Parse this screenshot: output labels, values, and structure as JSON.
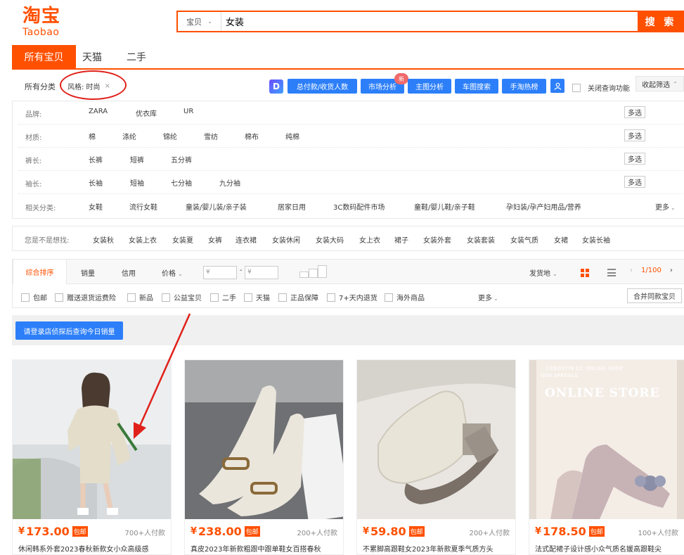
{
  "logo": {
    "cn": "淘宝",
    "en": "Taobao"
  },
  "search": {
    "scope": "宝贝",
    "value": "女装",
    "button": "搜 索"
  },
  "tabs": [
    "所有宝贝",
    "天猫",
    "二手"
  ],
  "crumb": {
    "label": "所有分类",
    "tag": "风格: 时尚",
    "close": "×"
  },
  "tools": {
    "d_icon": "D",
    "buttons": [
      "总付款/收货人数",
      "市场分析",
      "主图分析",
      "车图搜索",
      "手淘热榜"
    ],
    "new_badge": "新",
    "close_query": "关闭查询功能",
    "collapse": "收起筛选"
  },
  "filters": [
    {
      "label": "品牌:",
      "items": [
        "ZARA",
        "优衣库",
        "UR"
      ],
      "action": "多选"
    },
    {
      "label": "材质:",
      "items": [
        "棉",
        "涤纶",
        "锦纶",
        "雪纺",
        "棉布",
        "纯棉"
      ],
      "action": "多选"
    },
    {
      "label": "裤长:",
      "items": [
        "长裤",
        "短裤",
        "五分裤"
      ],
      "action": "多选"
    },
    {
      "label": "袖长:",
      "items": [
        "长袖",
        "短袖",
        "七分袖",
        "九分袖"
      ],
      "action": "多选"
    },
    {
      "label": "相关分类:",
      "items": [
        "女鞋",
        "流行女鞋",
        "童装/婴儿装/亲子装",
        "居家日用",
        "3C数码配件市场",
        "童鞋/婴儿鞋/亲子鞋",
        "孕妇装/孕产妇用品/营养"
      ],
      "action": "更多"
    }
  ],
  "guess": {
    "label": "您是不是想找:",
    "items": [
      "女装秋",
      "女装上衣",
      "女装夏",
      "女裤",
      "连衣裙",
      "女装休闲",
      "女装大码",
      "女上衣",
      "裙子",
      "女装外套",
      "女装套装",
      "女装气质",
      "女裙",
      "女装长袖"
    ]
  },
  "sort": {
    "items": [
      "综合排序",
      "销量",
      "信用",
      "价格"
    ],
    "price_from": "¥",
    "price_sep": "-",
    "price_to": "¥",
    "location": "发货地",
    "page": "1/100"
  },
  "checkboxes": [
    "包邮",
    "赠送退货运费险",
    "新品",
    "公益宝贝",
    "二手",
    "天猫",
    "正品保障",
    "7+天内退货",
    "海外商品"
  ],
  "checkbox_more": "更多",
  "merge": "合并同款宝贝",
  "notice": "请登录店侦探后查询今日销量",
  "products": [
    {
      "yen": "¥",
      "price": "173.00",
      "badge": "包邮",
      "sales": "700+人付款",
      "title": "休闲韩系外套2023春秋新款女小众高级感"
    },
    {
      "yen": "¥",
      "price": "238.00",
      "badge": "包邮",
      "sales": "200+人付款",
      "title": "真皮2023年新款粗跟中跟单鞋女百搭春秋"
    },
    {
      "yen": "¥",
      "price": "59.80",
      "badge": "包邮",
      "sales": "200+人付款",
      "title": "不累脚高跟鞋女2023年新款夏季气质方头"
    },
    {
      "yen": "¥",
      "price": "178.50",
      "badge": "包邮",
      "sales": "100+人付款",
      "title": "法式配裙子设计感小众气质名媛高跟鞋尖"
    }
  ],
  "product4_banner": {
    "brand": "CEBOSTIN CC ONLINE SHOP",
    "sub": "NEW ARRIVALS",
    "headline": "ONLINE STORE"
  },
  "colors": {
    "accent": "#ff5000",
    "tool_blue": "#2d7ff9",
    "annotation_red": "#e0201a"
  }
}
